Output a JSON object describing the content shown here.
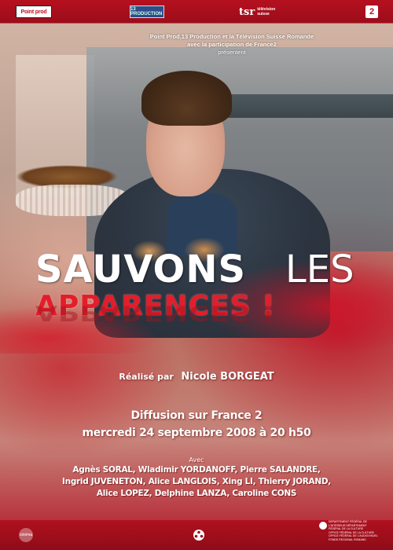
{
  "logos": {
    "top_left": "Point prod",
    "top_center": "13 PRODUCTION",
    "top_right_mark": "tsr",
    "top_right_text_1": "télévision",
    "top_right_text_2": "suisse",
    "france2": "2",
    "bottom_left": "cinéma"
  },
  "credits_top": {
    "line1": "Point Prod,13 Production et la Télévision Suisse Romande",
    "line2": "avec la participation de France2",
    "line3": "présentent"
  },
  "title": {
    "word1": "SAUVONS",
    "word2": "LES",
    "word3": "APPARENCES !"
  },
  "director": {
    "label": "Réalisé par",
    "name": "Nicole BORGEAT"
  },
  "diffusion": {
    "line1": "Diffusion sur France 2",
    "line2": "mercredi 24 septembre 2008 à 20 h50"
  },
  "cast": {
    "label": "Avec",
    "line1": "Agnès SORAL, Wladimir YORDANOFF, Pierre SALANDRE,",
    "line2": "Ingrid JUVENETON, Alice LANGLOIS, Xing LI, Thierry JORAND,",
    "line3": "Alice LOPEZ, Delphine LANZA, Caroline CONS"
  },
  "fine_print": [
    "DEPARTEMENT FÉDÉRAL DE",
    "L'INTÉRIEUR DÉPARTEMENT",
    "FÉDÉRAL DE LA CULTURE",
    "OFFICE FÉDÉRAL DE LA CULTURE",
    "OFFICE FÉDÉRAL DE L'AUDIOVISUEL",
    "FONDS REGIONAL ROMAND"
  ],
  "colors": {
    "title_red": "#e41d2b",
    "bar_red": "#b0101f",
    "text_white": "#ffffff"
  }
}
